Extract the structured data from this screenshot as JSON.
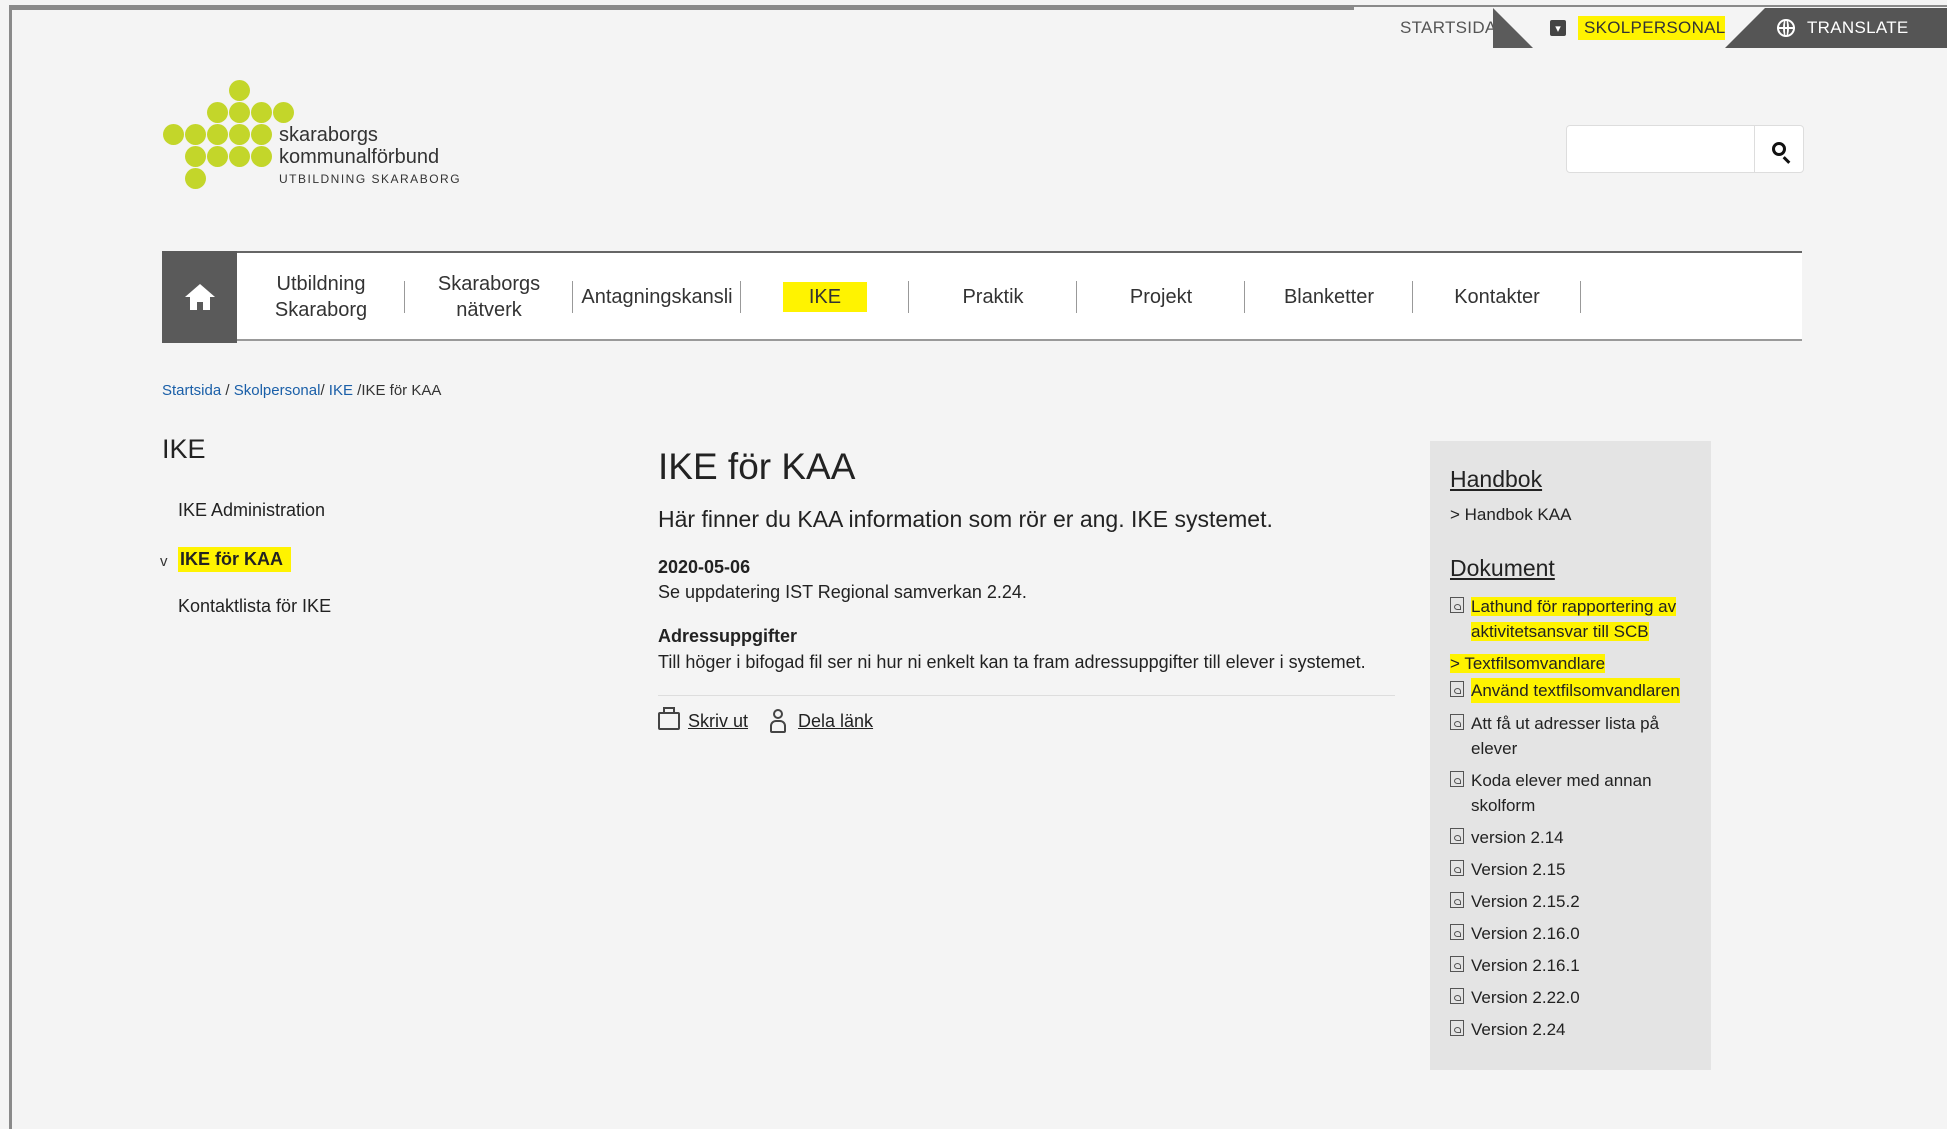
{
  "topbar": {
    "start": "STARTSIDA",
    "school": "SKOLPERSONAL",
    "translate": "TRANSLATE"
  },
  "logo": {
    "line1": "skaraborgs",
    "line2": "kommunalförbund",
    "line3": "UTBILDNING SKARABORG"
  },
  "search": {
    "placeholder": ""
  },
  "nav": {
    "items": [
      {
        "l1": "Utbildning",
        "l2": "Skaraborg"
      },
      {
        "l1": "Skaraborgs",
        "l2": "nätverk"
      },
      {
        "l1": "Antagningskansli",
        "l2": ""
      },
      {
        "l1": "IKE",
        "l2": ""
      },
      {
        "l1": "Praktik",
        "l2": ""
      },
      {
        "l1": "Projekt",
        "l2": ""
      },
      {
        "l1": "Blanketter",
        "l2": ""
      },
      {
        "l1": "Kontakter",
        "l2": ""
      }
    ]
  },
  "breadcrumb": {
    "c1": "Startsida",
    "c2": "Skolpersonal",
    "c3": "IKE",
    "current": "IKE för KAA"
  },
  "left": {
    "title": "IKE",
    "items": [
      "IKE Administration",
      "IKE för KAA",
      "Kontaktlista för IKE"
    ],
    "marker": "v"
  },
  "main": {
    "title": "IKE för KAA",
    "lead": "Här finner du KAA information som rör er ang. IKE systemet.",
    "date": "2020-05-06",
    "p1": "Se uppdatering IST Regional samverkan 2.24.",
    "h_addr": "Adressuppgifter",
    "p2": "Till höger i bifogad fil ser ni hur ni enkelt kan ta fram adressuppgifter till elever i systemet.",
    "print": "Skriv ut",
    "share": "Dela länk"
  },
  "right": {
    "h1": "Handbok",
    "handbok_link": "> Handbok KAA",
    "h2": "Dokument",
    "docs": [
      {
        "a": "Lathund för rapportering av",
        "b": "aktivitetsansvar till SCB"
      },
      {
        "a": "> Textfilsomvandlare",
        "b": ""
      },
      {
        "a": "Använd textfilsomvandlaren",
        "b": ""
      },
      {
        "a": "Att få ut adresser lista på",
        "b": "elever"
      },
      {
        "a": "Koda elever med annan",
        "b": "skolform"
      },
      {
        "a": "version 2.14",
        "b": ""
      },
      {
        "a": "Version 2.15",
        "b": ""
      },
      {
        "a": "Version 2.15.2",
        "b": ""
      },
      {
        "a": "Version 2.16.0",
        "b": ""
      },
      {
        "a": "Version 2.16.1",
        "b": ""
      },
      {
        "a": "Version 2.22.0",
        "b": ""
      },
      {
        "a": "Version 2.24",
        "b": ""
      }
    ]
  },
  "colors": {
    "highlight": "#fff300",
    "logo_green": "#c3d62a",
    "link_blue": "#1a5fa8"
  }
}
